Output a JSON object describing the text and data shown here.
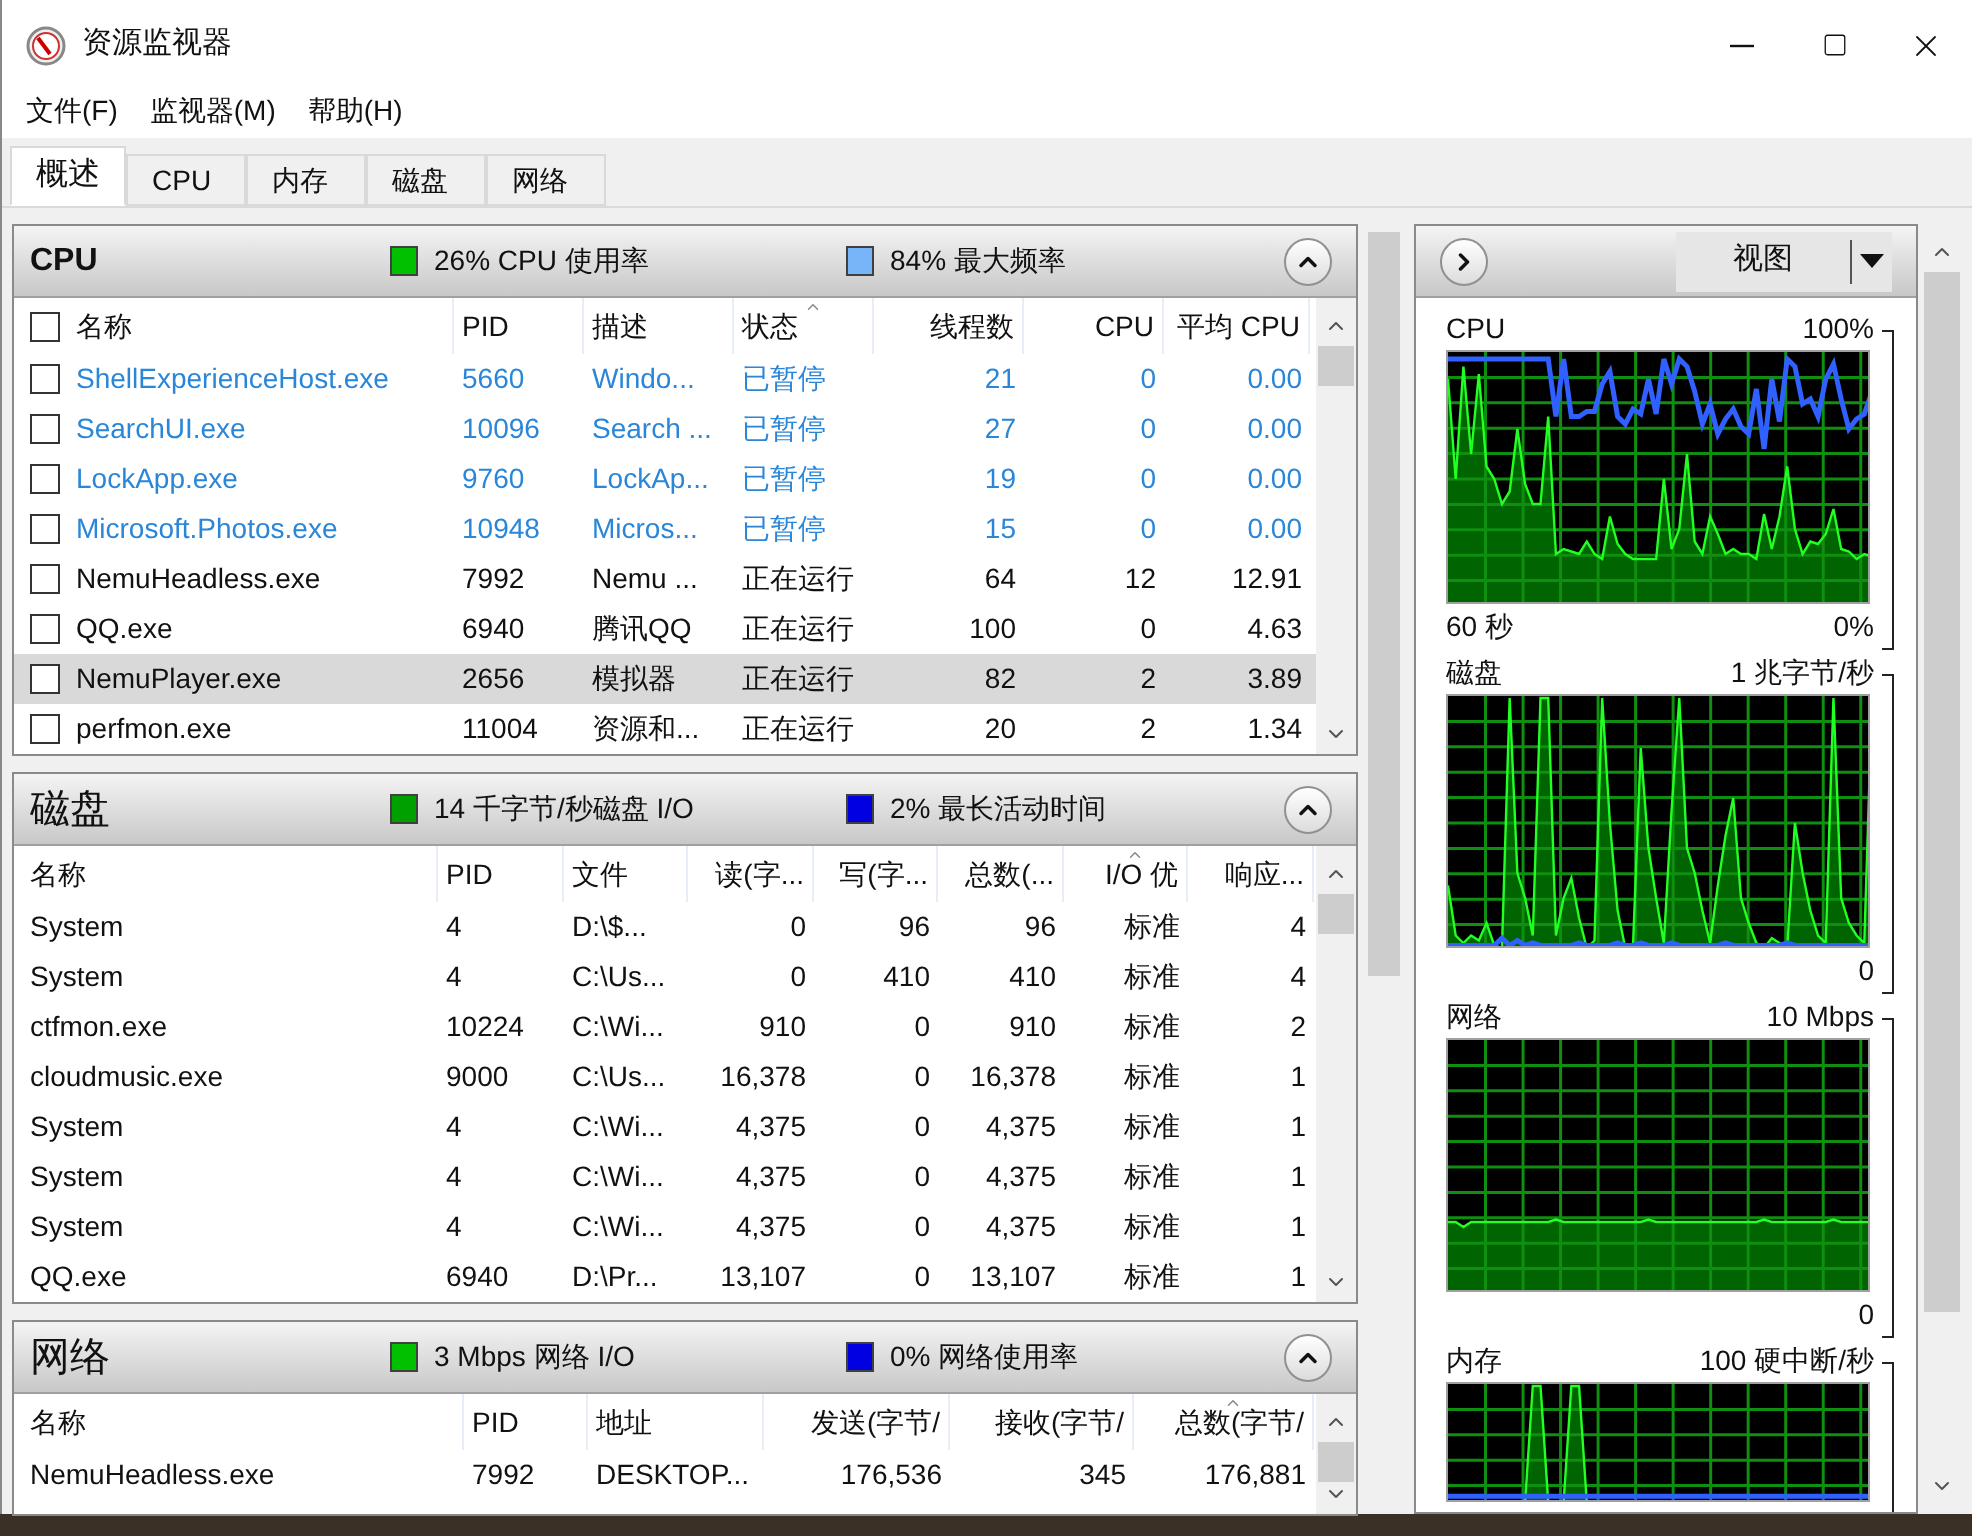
{
  "window": {
    "title": "资源监视器"
  },
  "menu": [
    "文件(F)",
    "监视器(M)",
    "帮助(H)"
  ],
  "tabs": [
    {
      "label": "概述",
      "selected": true
    },
    {
      "label": "CPU",
      "selected": false
    },
    {
      "label": "内存",
      "selected": false
    },
    {
      "label": "磁盘",
      "selected": false
    },
    {
      "label": "网络",
      "selected": false
    }
  ],
  "sections": [
    {
      "title": "CPU",
      "expanded": true,
      "header_checked": false,
      "indicators": [
        {
          "text": "26% CPU 使用率",
          "color": "#00c000"
        },
        {
          "text": "84% 最大频率",
          "color": "#78b4f8"
        }
      ],
      "columns": [
        {
          "label": "名称",
          "kind": "text",
          "sorted": false
        },
        {
          "label": "PID",
          "kind": "text",
          "sorted": false
        },
        {
          "label": "描述",
          "kind": "text",
          "sorted": false
        },
        {
          "label": "状态",
          "kind": "text",
          "sorted": true
        },
        {
          "label": "线程数",
          "kind": "number",
          "sorted": false
        },
        {
          "label": "CPU",
          "kind": "number",
          "sorted": false
        },
        {
          "label": "平均 CPU",
          "kind": "number",
          "sorted": false
        }
      ],
      "rows": [
        {
          "checked": false,
          "selected": false,
          "suspended": true,
          "cells": [
            "ShellExperienceHost.exe",
            "5660",
            "Windo...",
            "已暂停",
            "21",
            "0",
            "0.00"
          ]
        },
        {
          "checked": false,
          "selected": false,
          "suspended": true,
          "cells": [
            "SearchUI.exe",
            "10096",
            "Search ...",
            "已暂停",
            "27",
            "0",
            "0.00"
          ]
        },
        {
          "checked": false,
          "selected": false,
          "suspended": true,
          "cells": [
            "LockApp.exe",
            "9760",
            "LockAp...",
            "已暂停",
            "19",
            "0",
            "0.00"
          ]
        },
        {
          "checked": false,
          "selected": false,
          "suspended": true,
          "cells": [
            "Microsoft.Photos.exe",
            "10948",
            "Micros...",
            "已暂停",
            "15",
            "0",
            "0.00"
          ]
        },
        {
          "checked": false,
          "selected": false,
          "suspended": false,
          "cells": [
            "NemuHeadless.exe",
            "7992",
            "Nemu ...",
            "正在运行",
            "64",
            "12",
            "12.91"
          ]
        },
        {
          "checked": false,
          "selected": false,
          "suspended": false,
          "cells": [
            "QQ.exe",
            "6940",
            "腾讯QQ",
            "正在运行",
            "100",
            "0",
            "4.63"
          ]
        },
        {
          "checked": false,
          "selected": true,
          "suspended": false,
          "cells": [
            "NemuPlayer.exe",
            "2656",
            "模拟器",
            "正在运行",
            "82",
            "2",
            "3.89"
          ]
        },
        {
          "checked": false,
          "selected": false,
          "suspended": false,
          "cells": [
            "perfmon.exe",
            "11004",
            "资源和...",
            "正在运行",
            "20",
            "2",
            "1.34"
          ]
        }
      ]
    },
    {
      "title": "磁盘",
      "expanded": true,
      "indicators": [
        {
          "text": "14 千字节/秒磁盘 I/O",
          "color": "#00a000"
        },
        {
          "text": "2% 最长活动时间",
          "color": "#0000e0"
        }
      ],
      "columns": [
        {
          "label": "名称",
          "kind": "text",
          "sorted": false
        },
        {
          "label": "PID",
          "kind": "text",
          "sorted": false
        },
        {
          "label": "文件",
          "kind": "text",
          "sorted": false
        },
        {
          "label": "读(字...",
          "kind": "number",
          "sorted": false
        },
        {
          "label": "写(字...",
          "kind": "number",
          "sorted": false
        },
        {
          "label": "总数(...",
          "kind": "number",
          "sorted": false
        },
        {
          "label": "I/O 优",
          "kind": "number",
          "sorted": true
        },
        {
          "label": "响应...",
          "kind": "number",
          "sorted": false
        }
      ],
      "rows": [
        {
          "selected": false,
          "suspended": false,
          "cells": [
            "System",
            "4",
            "D:\\$...",
            "0",
            "96",
            "96",
            "标准",
            "4"
          ]
        },
        {
          "selected": false,
          "suspended": false,
          "cells": [
            "System",
            "4",
            "C:\\Us...",
            "0",
            "410",
            "410",
            "标准",
            "4"
          ]
        },
        {
          "selected": false,
          "suspended": false,
          "cells": [
            "ctfmon.exe",
            "10224",
            "C:\\Wi...",
            "910",
            "0",
            "910",
            "标准",
            "2"
          ]
        },
        {
          "selected": false,
          "suspended": false,
          "cells": [
            "cloudmusic.exe",
            "9000",
            "C:\\Us...",
            "16,378",
            "0",
            "16,378",
            "标准",
            "1"
          ]
        },
        {
          "selected": false,
          "suspended": false,
          "cells": [
            "System",
            "4",
            "C:\\Wi...",
            "4,375",
            "0",
            "4,375",
            "标准",
            "1"
          ]
        },
        {
          "selected": false,
          "suspended": false,
          "cells": [
            "System",
            "4",
            "C:\\Wi...",
            "4,375",
            "0",
            "4,375",
            "标准",
            "1"
          ]
        },
        {
          "selected": false,
          "suspended": false,
          "cells": [
            "System",
            "4",
            "C:\\Wi...",
            "4,375",
            "0",
            "4,375",
            "标准",
            "1"
          ]
        },
        {
          "selected": false,
          "suspended": false,
          "cells": [
            "QQ.exe",
            "6940",
            "D:\\Pr...",
            "13,107",
            "0",
            "13,107",
            "标准",
            "1"
          ]
        }
      ]
    },
    {
      "title": "网络",
      "expanded": true,
      "indicators": [
        {
          "text": "3 Mbps 网络 I/O",
          "color": "#00c000"
        },
        {
          "text": "0% 网络使用率",
          "color": "#0000e0"
        }
      ],
      "columns": [
        {
          "label": "名称",
          "kind": "text",
          "sorted": false
        },
        {
          "label": "PID",
          "kind": "text",
          "sorted": false
        },
        {
          "label": "地址",
          "kind": "text",
          "sorted": false
        },
        {
          "label": "发送(字节/",
          "kind": "number",
          "sorted": false
        },
        {
          "label": "接收(字节/",
          "kind": "number",
          "sorted": false
        },
        {
          "label": "总数(字节/",
          "kind": "number",
          "sorted": true
        }
      ],
      "rows": [
        {
          "selected": false,
          "suspended": false,
          "cells": [
            "NemuHeadless.exe",
            "7992",
            "DESKTOP...",
            "176,536",
            "345",
            "176,881"
          ]
        }
      ]
    }
  ],
  "side": {
    "view_button": "视图",
    "graphs": [
      {
        "title": "CPU",
        "scale": "100%",
        "time": "60 秒",
        "min": "0%"
      },
      {
        "title": "磁盘",
        "scale": "1 兆字节/秒",
        "min": "0"
      },
      {
        "title": "网络",
        "scale": "10 Mbps",
        "min": "0"
      },
      {
        "title": "内存",
        "scale": "100 硬中断/秒"
      }
    ]
  }
}
